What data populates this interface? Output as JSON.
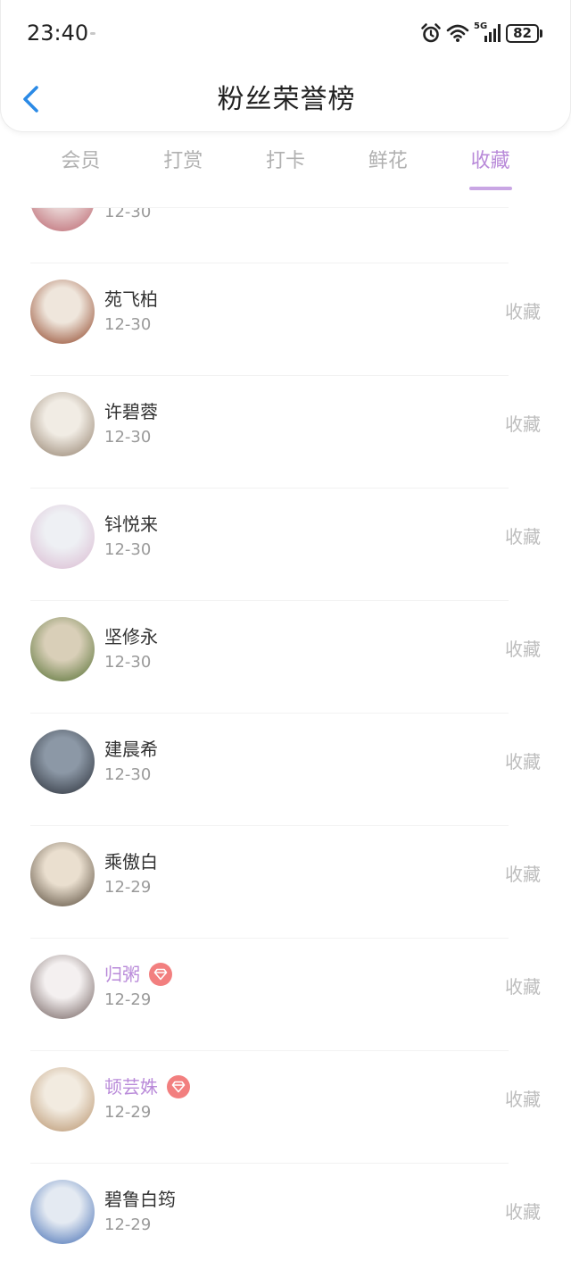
{
  "status_bar": {
    "time": "23:40",
    "network": "5G",
    "battery": "82"
  },
  "header": {
    "title": "粉丝荣誉榜"
  },
  "tabs": [
    {
      "label": "会员",
      "active": false
    },
    {
      "label": "打赏",
      "active": false
    },
    {
      "label": "打卡",
      "active": false
    },
    {
      "label": "鲜花",
      "active": false
    },
    {
      "label": "收藏",
      "active": true
    }
  ],
  "colors": {
    "accent": "#b98ad9",
    "accent_light": "#c9a6e4",
    "back_icon": "#2b8ae6",
    "badge": "#f27f7f"
  },
  "list": [
    {
      "date": "12-30",
      "avatar_colors": [
        "#e7cfcf",
        "#b9606a"
      ]
    },
    {
      "name": "苑飞柏",
      "date": "12-30",
      "action": "收藏",
      "vip": false,
      "avatar_colors": [
        "#efe6dc",
        "#8a3a1c"
      ]
    },
    {
      "name": "许碧蓉",
      "date": "12-30",
      "action": "收藏",
      "vip": false,
      "avatar_colors": [
        "#f1ece4",
        "#8d7a66"
      ]
    },
    {
      "name": "钭悦来",
      "date": "12-30",
      "action": "收藏",
      "vip": false,
      "avatar_colors": [
        "#eef0f4",
        "#d9b7cf"
      ]
    },
    {
      "name": "坚修永",
      "date": "12-30",
      "action": "收藏",
      "vip": false,
      "avatar_colors": [
        "#d9cfb8",
        "#4d6a2a"
      ]
    },
    {
      "name": "建晨希",
      "date": "12-30",
      "action": "收藏",
      "vip": false,
      "avatar_colors": [
        "#8c98a6",
        "#262b34"
      ]
    },
    {
      "name": "乘傲白",
      "date": "12-29",
      "action": "收藏",
      "vip": false,
      "avatar_colors": [
        "#eadfcf",
        "#4f4232"
      ]
    },
    {
      "name": "归粥",
      "date": "12-29",
      "action": "收藏",
      "vip": true,
      "avatar_colors": [
        "#f4f0f0",
        "#6a5856"
      ]
    },
    {
      "name": "顿芸姝",
      "date": "12-29",
      "action": "收藏",
      "vip": true,
      "avatar_colors": [
        "#f2ebe0",
        "#b58e66"
      ]
    },
    {
      "name": "碧鲁白筠",
      "date": "12-29",
      "action": "收藏",
      "vip": false,
      "avatar_colors": [
        "#e4eaf2",
        "#3a66b0"
      ]
    }
  ]
}
